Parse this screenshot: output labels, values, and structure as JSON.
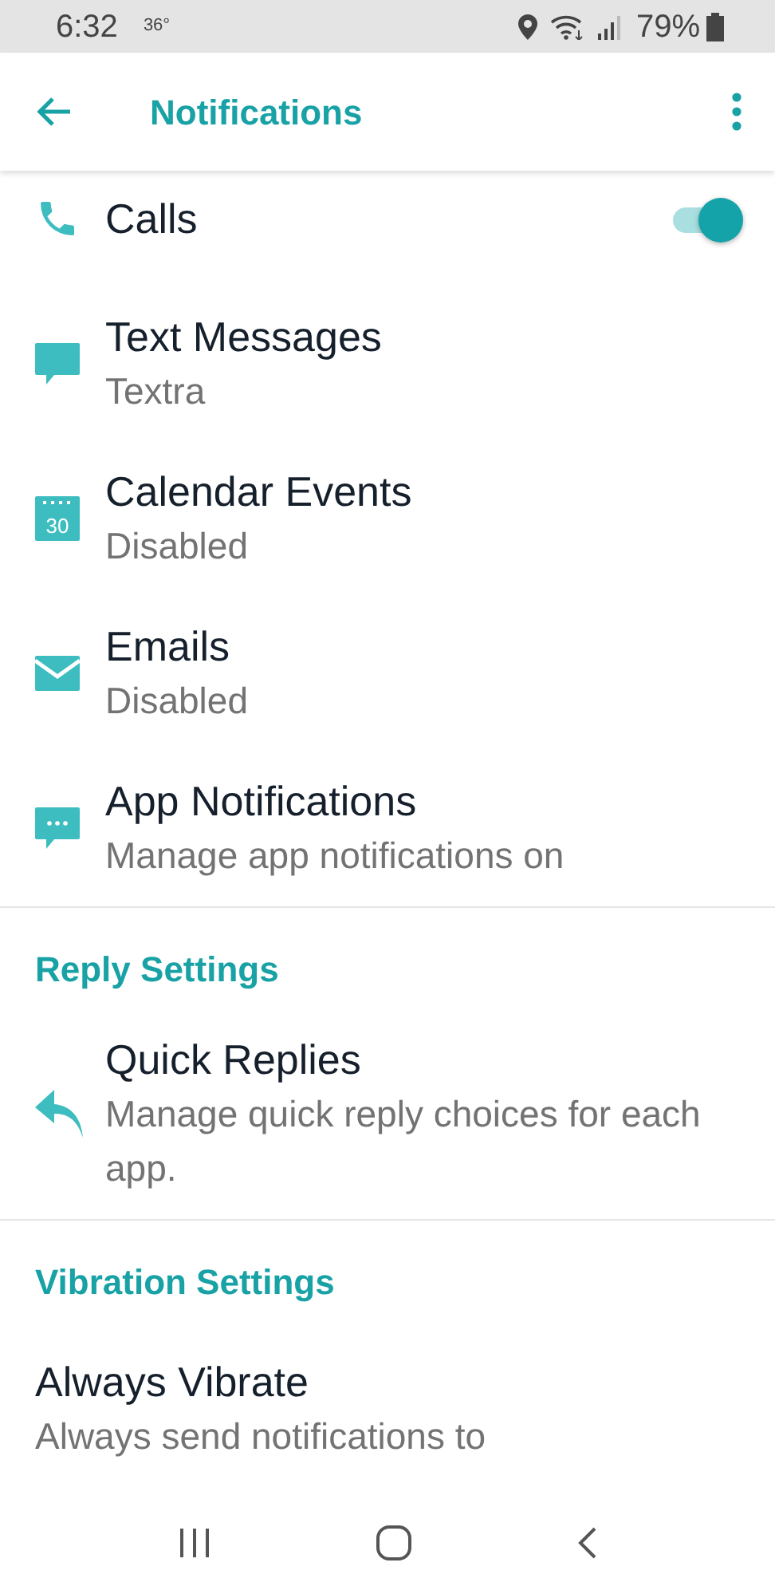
{
  "status_bar": {
    "time": "6:32",
    "temperature": "36°",
    "battery": "79%"
  },
  "header": {
    "title": "Notifications"
  },
  "items": [
    {
      "kind": "calls",
      "title": "Calls",
      "on": true
    },
    {
      "kind": "message",
      "title": "Text Messages",
      "subtitle": "Textra"
    },
    {
      "kind": "calendar",
      "title": "Calendar Events",
      "subtitle": "Disabled",
      "icon_text": "30"
    },
    {
      "kind": "email",
      "title": "Emails",
      "subtitle": "Disabled"
    },
    {
      "kind": "app",
      "title": "App Notifications",
      "subtitle": "Manage app notifications on"
    }
  ],
  "sections": [
    {
      "heading": "Reply Settings",
      "items": [
        {
          "kind": "reply",
          "title": "Quick Replies",
          "subtitle": "Manage quick reply choices for each app."
        }
      ]
    },
    {
      "heading": "Vibration Settings",
      "items": [
        {
          "kind": "plain",
          "title": "Always Vibrate",
          "subtitle": "Always send notifications to"
        }
      ]
    }
  ]
}
